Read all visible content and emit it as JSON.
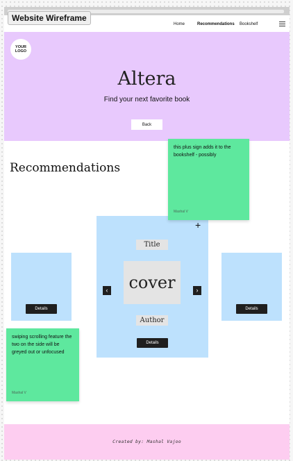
{
  "frame_label": "Website Wireframe",
  "nav": {
    "items": [
      {
        "label": "Home"
      },
      {
        "label": "Recommendations",
        "active": true
      },
      {
        "label": "Bookshelf"
      }
    ],
    "menu_icon": "hamburger-menu-icon"
  },
  "hero": {
    "logo_text": "YOUR LOGO",
    "title": "Altera",
    "subtitle": "Find your next favorite book",
    "back_label": "Back"
  },
  "recommendations": {
    "heading": "Recommendations",
    "main_card": {
      "title": "Title",
      "cover": "cover",
      "author": "Author",
      "details_label": "Details",
      "add_icon": "plus-icon",
      "prev_icon": "chevron-left-icon",
      "next_icon": "chevron-right-icon"
    },
    "left_card": {
      "details_label": "Details"
    },
    "right_card": {
      "details_label": "Details"
    }
  },
  "notes": [
    {
      "text": "this plus sign adds it to the bookshelf - possibly",
      "author": "Mashal V"
    },
    {
      "text": "swiping scrolling feature the two on the side will be greyed out or unfocused",
      "author": "Mashal V"
    }
  ],
  "footer": {
    "text": "Created by: Mashal Vajoo"
  },
  "colors": {
    "hero_bg": "#e8c9fd",
    "card_bg": "#bde1fd",
    "sticky_note": "#5ee89e",
    "footer_bg": "#fdcdf0",
    "button_dark": "#1f1f1f"
  }
}
